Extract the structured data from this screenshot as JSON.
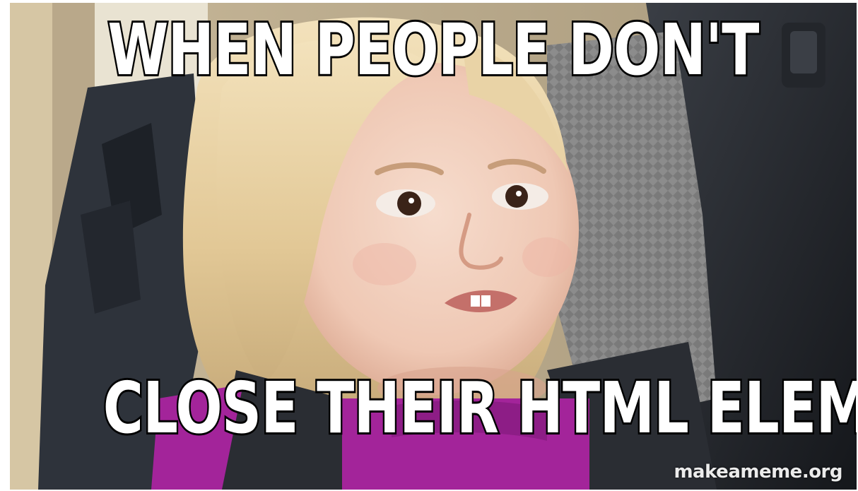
{
  "meme": {
    "top_text": "WHEN PEOPLE DON'T",
    "bottom_text": "CLOSE THEIR HTML ELEMENTS",
    "watermark": "makeameme.org"
  },
  "colors": {
    "caption_fill": "#ffffff",
    "caption_outline": "#000000",
    "shirt": "#a3249a",
    "hair": "#e8d2a4",
    "seat_dark": "#2b2f36",
    "seat_light": "#8a8a8a"
  }
}
